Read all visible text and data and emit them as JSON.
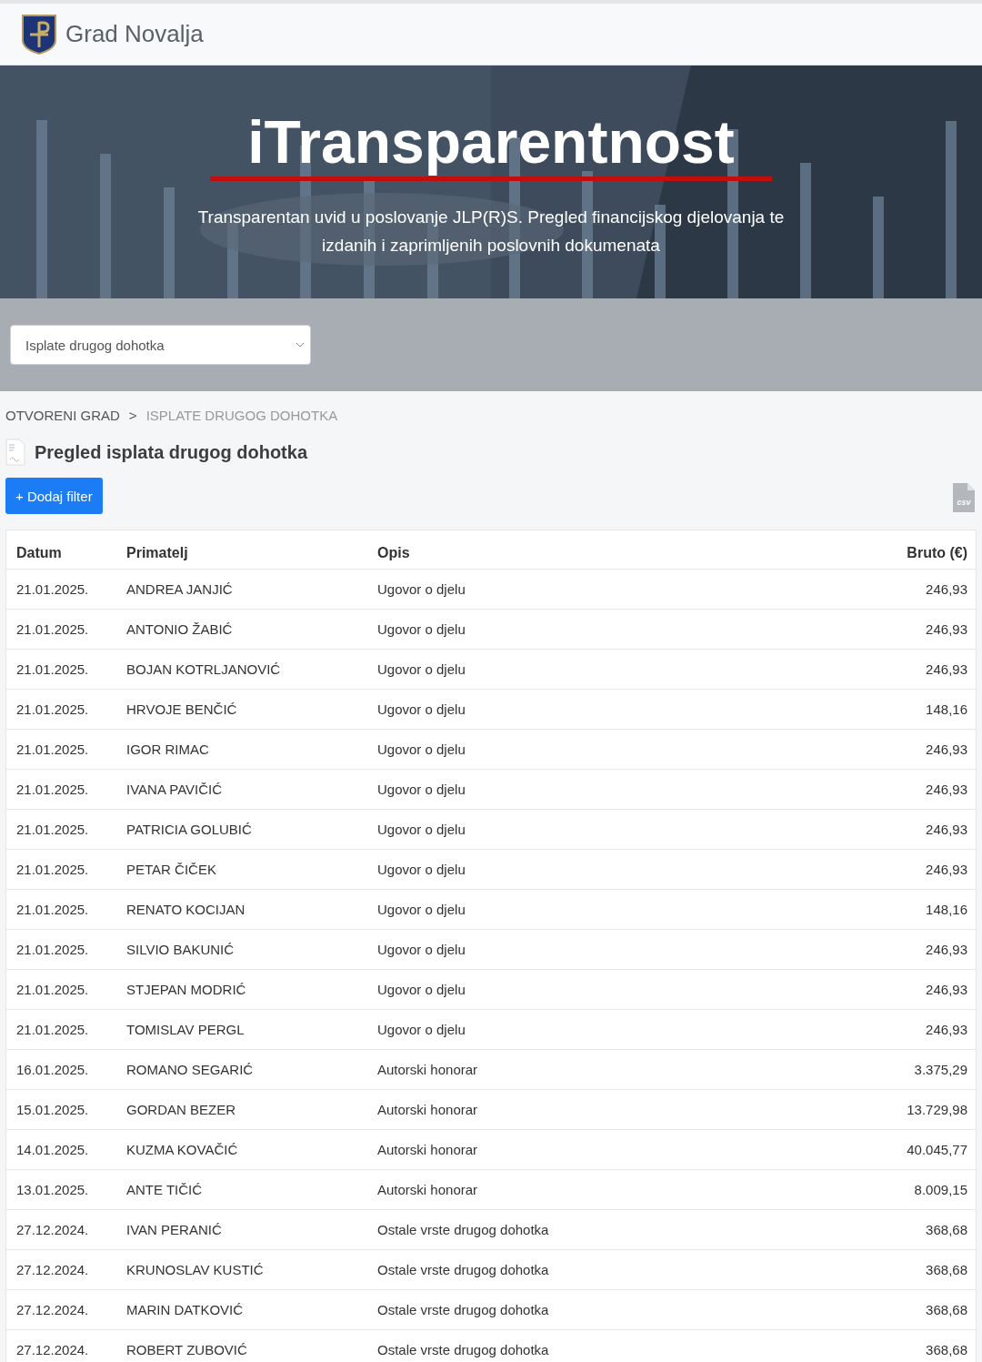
{
  "header": {
    "title": "Grad Novalja"
  },
  "hero": {
    "kind": "picture",
    "title": "iTransparentnost",
    "subtitle": "Transparentan uvid u poslovanje JLP(R)S. Pregled financijskog djelovanja te izdanih i zaprimljenih poslovnih dokumenata"
  },
  "selector": {
    "value": "Isplate drugog dohotka"
  },
  "breadcrumb": [
    {
      "label": "OTVORENI GRAD",
      "selected": false
    },
    {
      "label": "ISPLATE DRUGOG DOHOTKA",
      "selected": true
    }
  ],
  "breadcrumb_separator": ">",
  "page_title": "Pregled isplata drugog dohotka",
  "filter_button": "+ Dodaj filter",
  "export_label": "csv",
  "table": {
    "columns": [
      "Datum",
      "Primatelj",
      "Opis",
      "Bruto (€)"
    ],
    "rows": [
      [
        "21.01.2025.",
        "ANDREA JANJIĆ",
        "Ugovor o djelu",
        "246,93"
      ],
      [
        "21.01.2025.",
        "ANTONIO ŽABIĆ",
        "Ugovor o djelu",
        "246,93"
      ],
      [
        "21.01.2025.",
        "BOJAN KOTRLJANOVIĆ",
        "Ugovor o djelu",
        "246,93"
      ],
      [
        "21.01.2025.",
        "HRVOJE BENČIĆ",
        "Ugovor o djelu",
        "148,16"
      ],
      [
        "21.01.2025.",
        "IGOR RIMAC",
        "Ugovor o djelu",
        "246,93"
      ],
      [
        "21.01.2025.",
        "IVANA PAVIČIĆ",
        "Ugovor o djelu",
        "246,93"
      ],
      [
        "21.01.2025.",
        "PATRICIA GOLUBIĆ",
        "Ugovor o djelu",
        "246,93"
      ],
      [
        "21.01.2025.",
        "PETAR ČIČEK",
        "Ugovor o djelu",
        "246,93"
      ],
      [
        "21.01.2025.",
        "RENATO KOCIJAN",
        "Ugovor o djelu",
        "148,16"
      ],
      [
        "21.01.2025.",
        "SILVIO BAKUNIĆ",
        "Ugovor o djelu",
        "246,93"
      ],
      [
        "21.01.2025.",
        "STJEPAN MODRIĆ",
        "Ugovor o djelu",
        "246,93"
      ],
      [
        "21.01.2025.",
        "TOMISLAV PERGL",
        "Ugovor o djelu",
        "246,93"
      ],
      [
        "16.01.2025.",
        "ROMANO SEGARIĆ",
        "Autorski honorar",
        "3.375,29"
      ],
      [
        "15.01.2025.",
        "GORDAN BEZER",
        "Autorski honorar",
        "13.729,98"
      ],
      [
        "14.01.2025.",
        "KUZMA KOVAČIĆ",
        "Autorski honorar",
        "40.045,77"
      ],
      [
        "13.01.2025.",
        "ANTE TIČIĆ",
        "Autorski honorar",
        "8.009,15"
      ],
      [
        "27.12.2024.",
        "IVAN PERANIĆ",
        "Ostale vrste drugog dohotka",
        "368,68"
      ],
      [
        "27.12.2024.",
        "KRUNOSLAV KUSTIĆ",
        "Ostale vrste drugog dohotka",
        "368,68"
      ],
      [
        "27.12.2024.",
        "MARIN DATKOVIĆ",
        "Ostale vrste drugog dohotka",
        "368,68"
      ],
      [
        "27.12.2024.",
        "ROBERT ZUBOVIĆ",
        "Ostale vrste drugog dohotka",
        "368,68"
      ]
    ]
  }
}
